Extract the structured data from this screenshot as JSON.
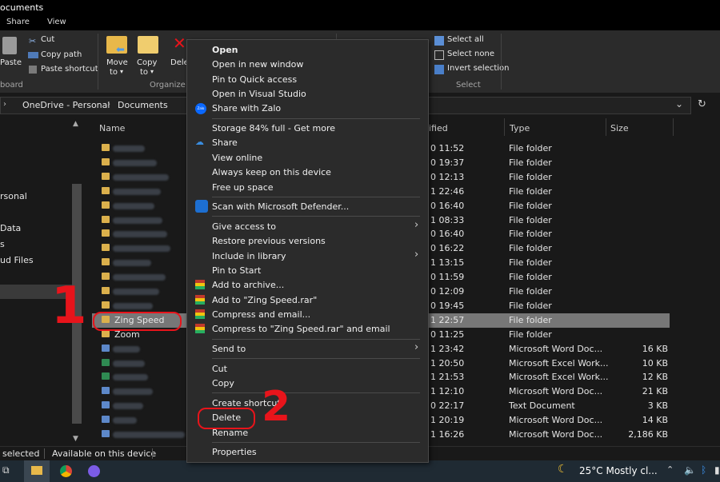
{
  "window": {
    "title_fragment": "ocuments"
  },
  "tabs": [
    "Share",
    "View"
  ],
  "ribbon": {
    "clipboard": {
      "paste": "Paste",
      "cut": "Cut",
      "copy_path": "Copy path",
      "paste_shortcut": "Paste shortcut",
      "group": "board"
    },
    "organize": {
      "move": "Move",
      "move_to": "to",
      "copy": "Copy",
      "copy_to": "to",
      "delete": "Dele",
      "group": "Organize"
    },
    "select": {
      "all": "Select all",
      "none": "Select none",
      "invert": "Invert selection",
      "group": "Select"
    }
  },
  "breadcrumb": [
    "OneDrive - Personal",
    "Documents"
  ],
  "nav": [
    "rsonal",
    "Data",
    "s",
    "ud Files"
  ],
  "columns": {
    "name": "Name",
    "modified": "ified",
    "type": "Type",
    "size": "Size"
  },
  "rows": [
    {
      "modified": "0 11:52",
      "type": "File folder",
      "size": "",
      "kind": "folder"
    },
    {
      "modified": "0 19:37",
      "type": "File folder",
      "size": "",
      "kind": "folder"
    },
    {
      "modified": "0 12:13",
      "type": "File folder",
      "size": "",
      "kind": "folder"
    },
    {
      "modified": "1 22:46",
      "type": "File folder",
      "size": "",
      "kind": "folder"
    },
    {
      "modified": "0 16:40",
      "type": "File folder",
      "size": "",
      "kind": "folder"
    },
    {
      "modified": "1 08:33",
      "type": "File folder",
      "size": "",
      "kind": "folder"
    },
    {
      "modified": "0 16:40",
      "type": "File folder",
      "size": "",
      "kind": "folder"
    },
    {
      "modified": "0 16:22",
      "type": "File folder",
      "size": "",
      "kind": "folder"
    },
    {
      "modified": "1 13:15",
      "type": "File folder",
      "size": "",
      "kind": "folder"
    },
    {
      "modified": "0 11:59",
      "type": "File folder",
      "size": "",
      "kind": "folder"
    },
    {
      "modified": "0 12:09",
      "type": "File folder",
      "size": "",
      "kind": "folder"
    },
    {
      "modified": "0 19:45",
      "type": "File folder",
      "size": "",
      "kind": "folder"
    },
    {
      "name": "Zing Speed",
      "modified": "1 22:57",
      "type": "File folder",
      "size": "",
      "kind": "folder",
      "selected": true
    },
    {
      "name": "Zoom",
      "modified": "0 11:25",
      "type": "File folder",
      "size": "",
      "kind": "folder"
    },
    {
      "modified": "1 23:42",
      "type": "Microsoft Word Doc...",
      "size": "16 KB",
      "kind": "doc"
    },
    {
      "modified": "1 20:50",
      "type": "Microsoft Excel Work...",
      "size": "10 KB",
      "kind": "xls"
    },
    {
      "modified": "1 21:53",
      "type": "Microsoft Excel Work...",
      "size": "12 KB",
      "kind": "xls"
    },
    {
      "modified": "1 12:10",
      "type": "Microsoft Word Doc...",
      "size": "21 KB",
      "kind": "doc"
    },
    {
      "modified": "0 22:17",
      "type": "Text Document",
      "size": "3 KB",
      "kind": "txt"
    },
    {
      "modified": "1 20:19",
      "type": "Microsoft Word Doc...",
      "size": "14 KB",
      "kind": "doc"
    },
    {
      "modified": "1 16:26",
      "type": "Microsoft Word Doc...",
      "size": "2,186 KB",
      "kind": "doc"
    }
  ],
  "status": {
    "selected": "selected",
    "availability": "Available on this device"
  },
  "taskbar": {
    "weather": "25°C  Mostly cl..."
  },
  "context_menu": {
    "open": "Open",
    "open_new_window": "Open in new window",
    "pin_quick": "Pin to Quick access",
    "open_vs": "Open in Visual Studio",
    "share_zalo": "Share with Zalo",
    "storage": "Storage 84% full - Get more",
    "share": "Share",
    "view_online": "View online",
    "always_keep": "Always keep on this device",
    "free_space": "Free up space",
    "defender": "Scan with Microsoft Defender...",
    "give_access": "Give access to",
    "restore": "Restore previous versions",
    "include_library": "Include in library",
    "pin_start": "Pin to Start",
    "add_archive": "Add to archive...",
    "add_rar": "Add to \"Zing Speed.rar\"",
    "compress_email": "Compress and email...",
    "compress_rar_email": "Compress to \"Zing Speed.rar\" and email",
    "send_to": "Send to",
    "cut": "Cut",
    "copy": "Copy",
    "create_shortcut": "Create shortcut",
    "delete": "Delete",
    "rename": "Rename",
    "properties": "Properties",
    "zalo_icon_text": "Zalo"
  },
  "annotations": {
    "step1": "1",
    "step2": "2"
  },
  "colors": {
    "accent_red": "#e8141b",
    "folder": "#dbb04c",
    "selected_row": "#777777"
  }
}
